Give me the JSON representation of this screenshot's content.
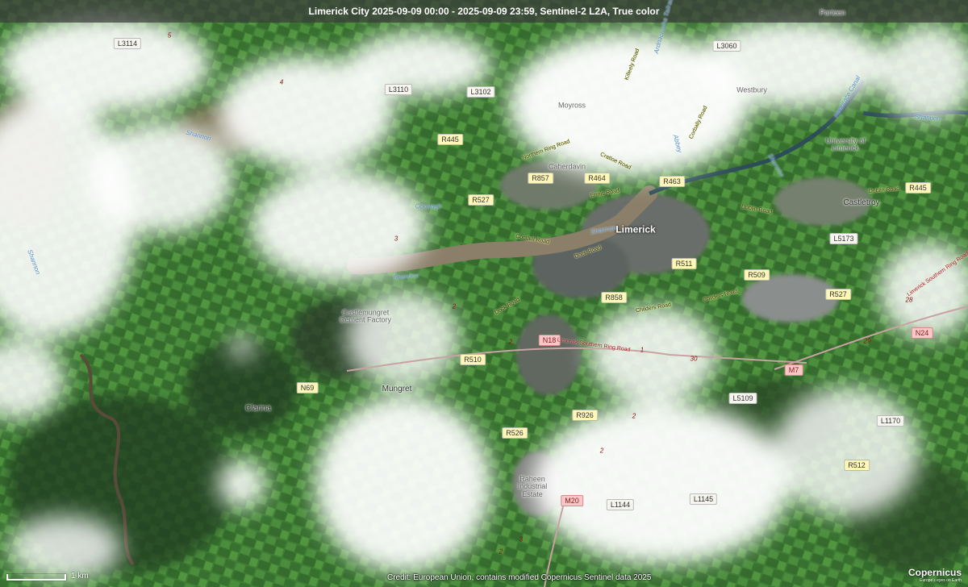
{
  "title": "Limerick City 2025-09-09 00:00 - 2025-09-09 23:59, Sentinel-2 L2A, True color",
  "scale_label": "1 km",
  "credit": "Credit: European Union, contains modified Copernicus Sentinel data 2025",
  "logo": {
    "name": "Copernicus",
    "tagline": "Europe's eyes on Earth"
  },
  "places": {
    "limerick": "Limerick",
    "castletroy": "Castletroy",
    "mungret": "Mungret",
    "clarina": "Clarina",
    "moyross": "Moyross",
    "westbury": "Westbury",
    "parteen": "Parteen",
    "caherdavin": "Caherdavin",
    "university": "University of Limerick",
    "castlemungret": "Castlemungret Cement Factory",
    "raheen": "Raheen Industrial Estate"
  },
  "roads": {
    "l3114": "L3114",
    "l3110": "L3110",
    "l3102": "L3102",
    "l3060": "L3060",
    "r445a": "R445",
    "r445b": "R445",
    "r857": "R857",
    "r464": "R464",
    "r463": "R463",
    "r527a": "R527",
    "r527b": "R527",
    "l5173": "L5173",
    "r511": "R511",
    "r509": "R509",
    "r858": "R858",
    "n18": "N18",
    "n24": "N24",
    "r510": "R510",
    "n69": "N69",
    "m7": "M7",
    "l5109": "L5109",
    "r926": "R926",
    "r526": "R526",
    "l1170": "L1170",
    "r512": "R512",
    "m20": "M20",
    "l1144": "L1144",
    "l1145": "L1145"
  },
  "water": {
    "shannon1": "Shannon",
    "shannon2": "Shannon",
    "shannon3": "Shannon",
    "shannon4": "Shannon",
    "shannon5": "Shannon",
    "shannon6": "Shannon",
    "abbey": "Abbey",
    "ardnacrusha": "Ardnacrusha Tailrace",
    "headrace": "Headrace Canal",
    "coonagh": "Coonagh"
  },
  "streets": {
    "killeely": "Killeely Road",
    "cratloe": "Cratloe Road",
    "northern_ring": "Northern Ring Road",
    "ennis": "Ennis Road",
    "corbally": "Corbally Road",
    "dublin1": "Dublin Road",
    "dublin2": "Dublin Road",
    "condell": "Condell Road",
    "dock": "Dock Road",
    "rockwell": "Rockwell",
    "childers1": "Childers Road",
    "childers2": "Childers Road",
    "southern_ring": "Limerick Southern Ring Road",
    "southern_ring2": "Limerick Southern Ring Road",
    "dock2": "Dock Road"
  },
  "junctions": {
    "j5": "5",
    "j4": "4",
    "j3": "3",
    "j2a": "2",
    "j2b": "2",
    "j1": "1",
    "j30": "30",
    "j29": "29",
    "j28": "28",
    "j2c": "2",
    "j2d": "2",
    "j3b": "3",
    "j2e": "2"
  }
}
